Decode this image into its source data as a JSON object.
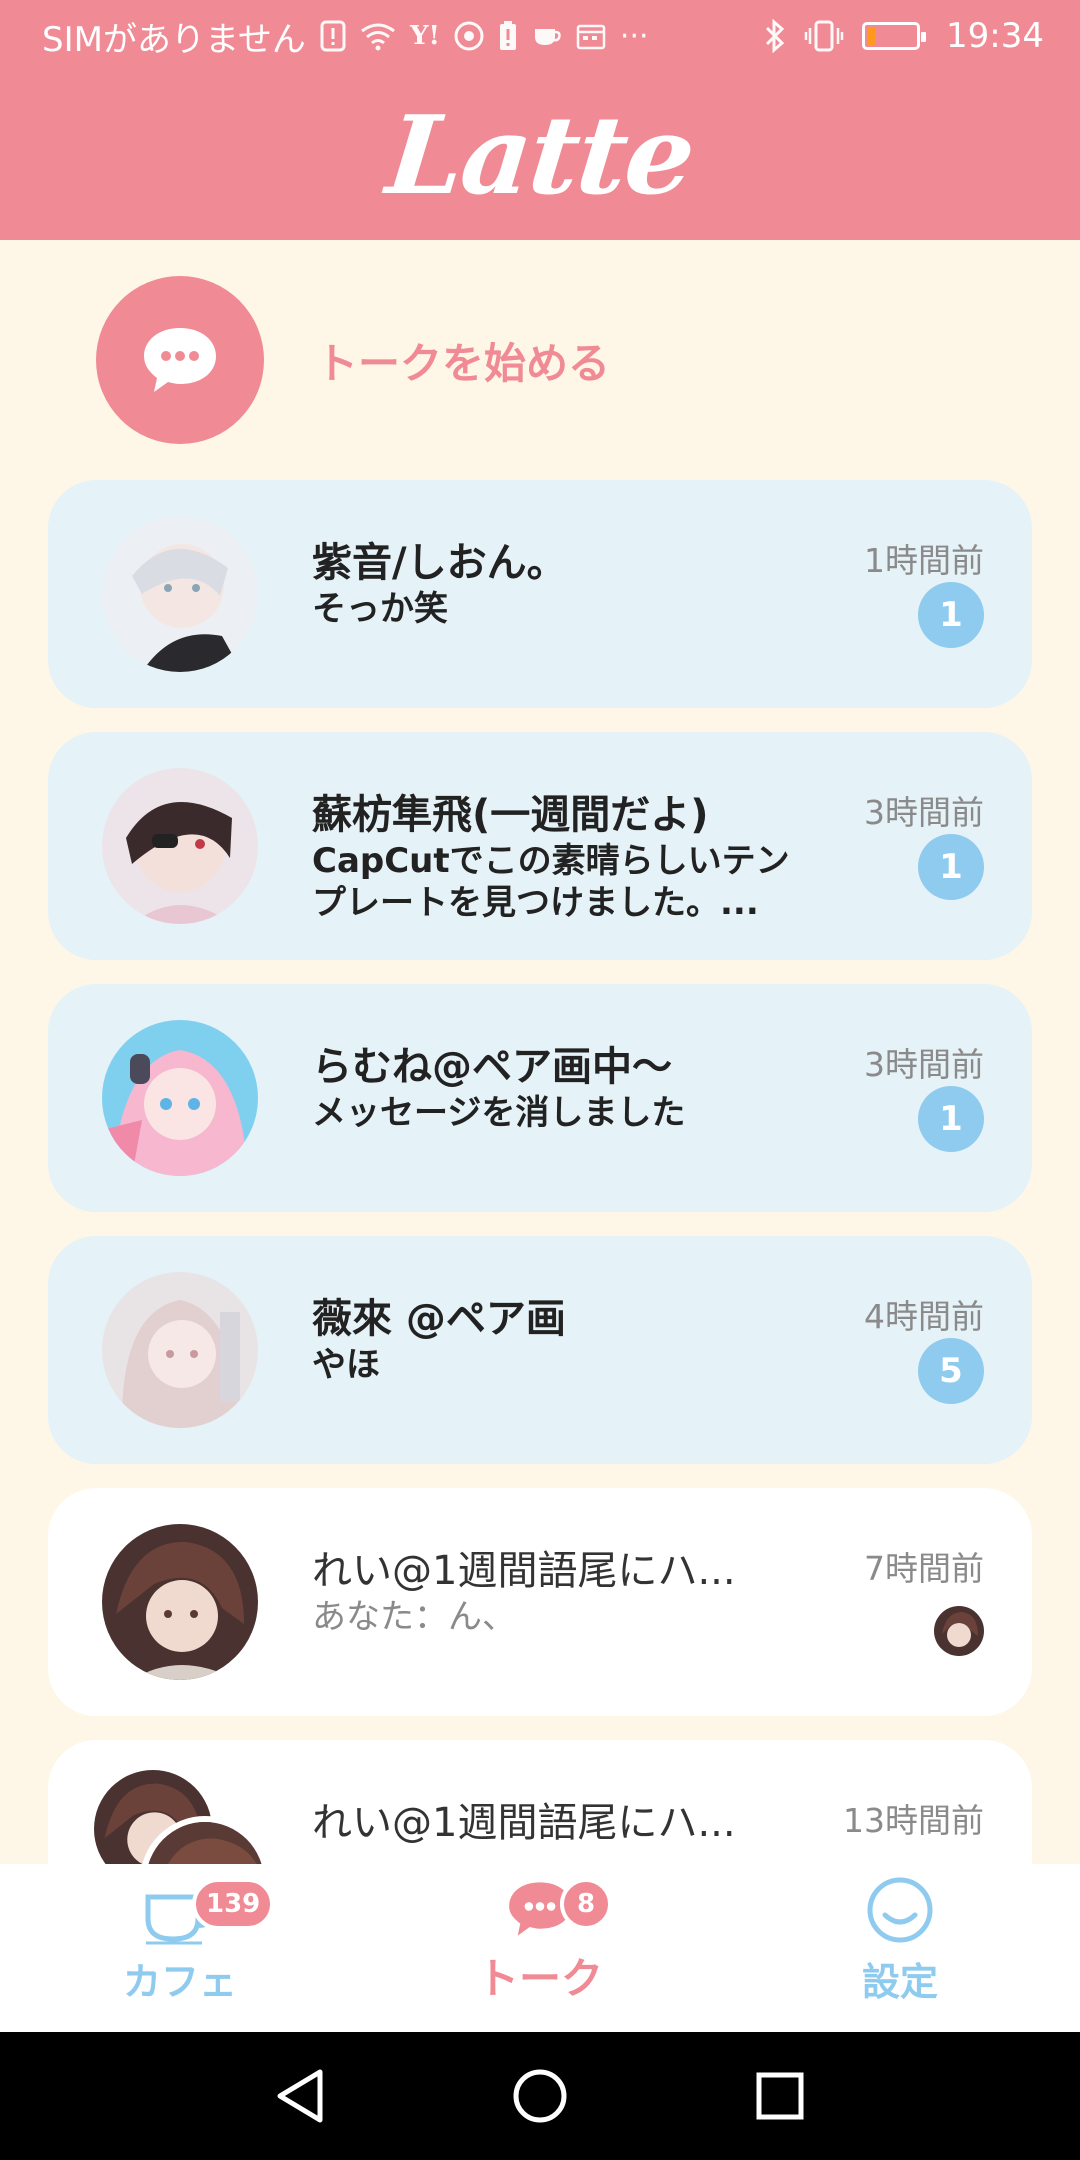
{
  "status_bar": {
    "carrier": "SIMがありません",
    "time": "19:34",
    "battery_level": 0.15,
    "battery_color": "#ff9a1e",
    "icons": [
      "alert-icon",
      "wifi-icon",
      "yahoo-icon",
      "chrome-icon",
      "battery-alert-icon",
      "cup-icon",
      "calendar-icon",
      "more-icon",
      "bluetooth-icon",
      "vibrate-icon",
      "battery-icon"
    ]
  },
  "header": {
    "logo": "Latte",
    "color": "#f08a94"
  },
  "start_talk": {
    "label": "トークを始める",
    "icon": "chat-bubble-icon"
  },
  "conversations": [
    {
      "name": "紫音/しおん。",
      "message": "そっか笑",
      "time": "1時間前",
      "unread": "1",
      "state": "unread"
    },
    {
      "name": "蘇枋隼飛(一週間だよ)",
      "message": "CapCutでこの素晴らしいテンプレートを見つけました。...",
      "time": "3時間前",
      "unread": "1",
      "state": "unread"
    },
    {
      "name": "らむね@ペア画中〜",
      "message": "メッセージを消しました",
      "time": "3時間前",
      "unread": "1",
      "state": "unread"
    },
    {
      "name": "薇來 @ペア画",
      "message": "やほ",
      "time": "4時間前",
      "unread": "5",
      "state": "unread"
    },
    {
      "name": "れい@1週間語尾にハ...",
      "message": "あなた：ん、",
      "time": "7時間前",
      "unread": "",
      "state": "read"
    },
    {
      "name": "れい@1週間語尾にハ...",
      "message": "",
      "time": "13時間前",
      "unread": "",
      "state": "read"
    }
  ],
  "bottom_nav": {
    "cafe": {
      "label": "カフェ",
      "badge": "139",
      "icon": "coffee-cup-icon"
    },
    "talk": {
      "label": "トーク",
      "badge": "8",
      "icon": "chat-bubble-icon"
    },
    "settings": {
      "label": "設定",
      "icon": "smiley-icon"
    }
  },
  "colors": {
    "accent_pink": "#f08a94",
    "accent_blue": "#8ecbee",
    "unread_card": "#e5f2f7",
    "background": "#fef7e7"
  }
}
